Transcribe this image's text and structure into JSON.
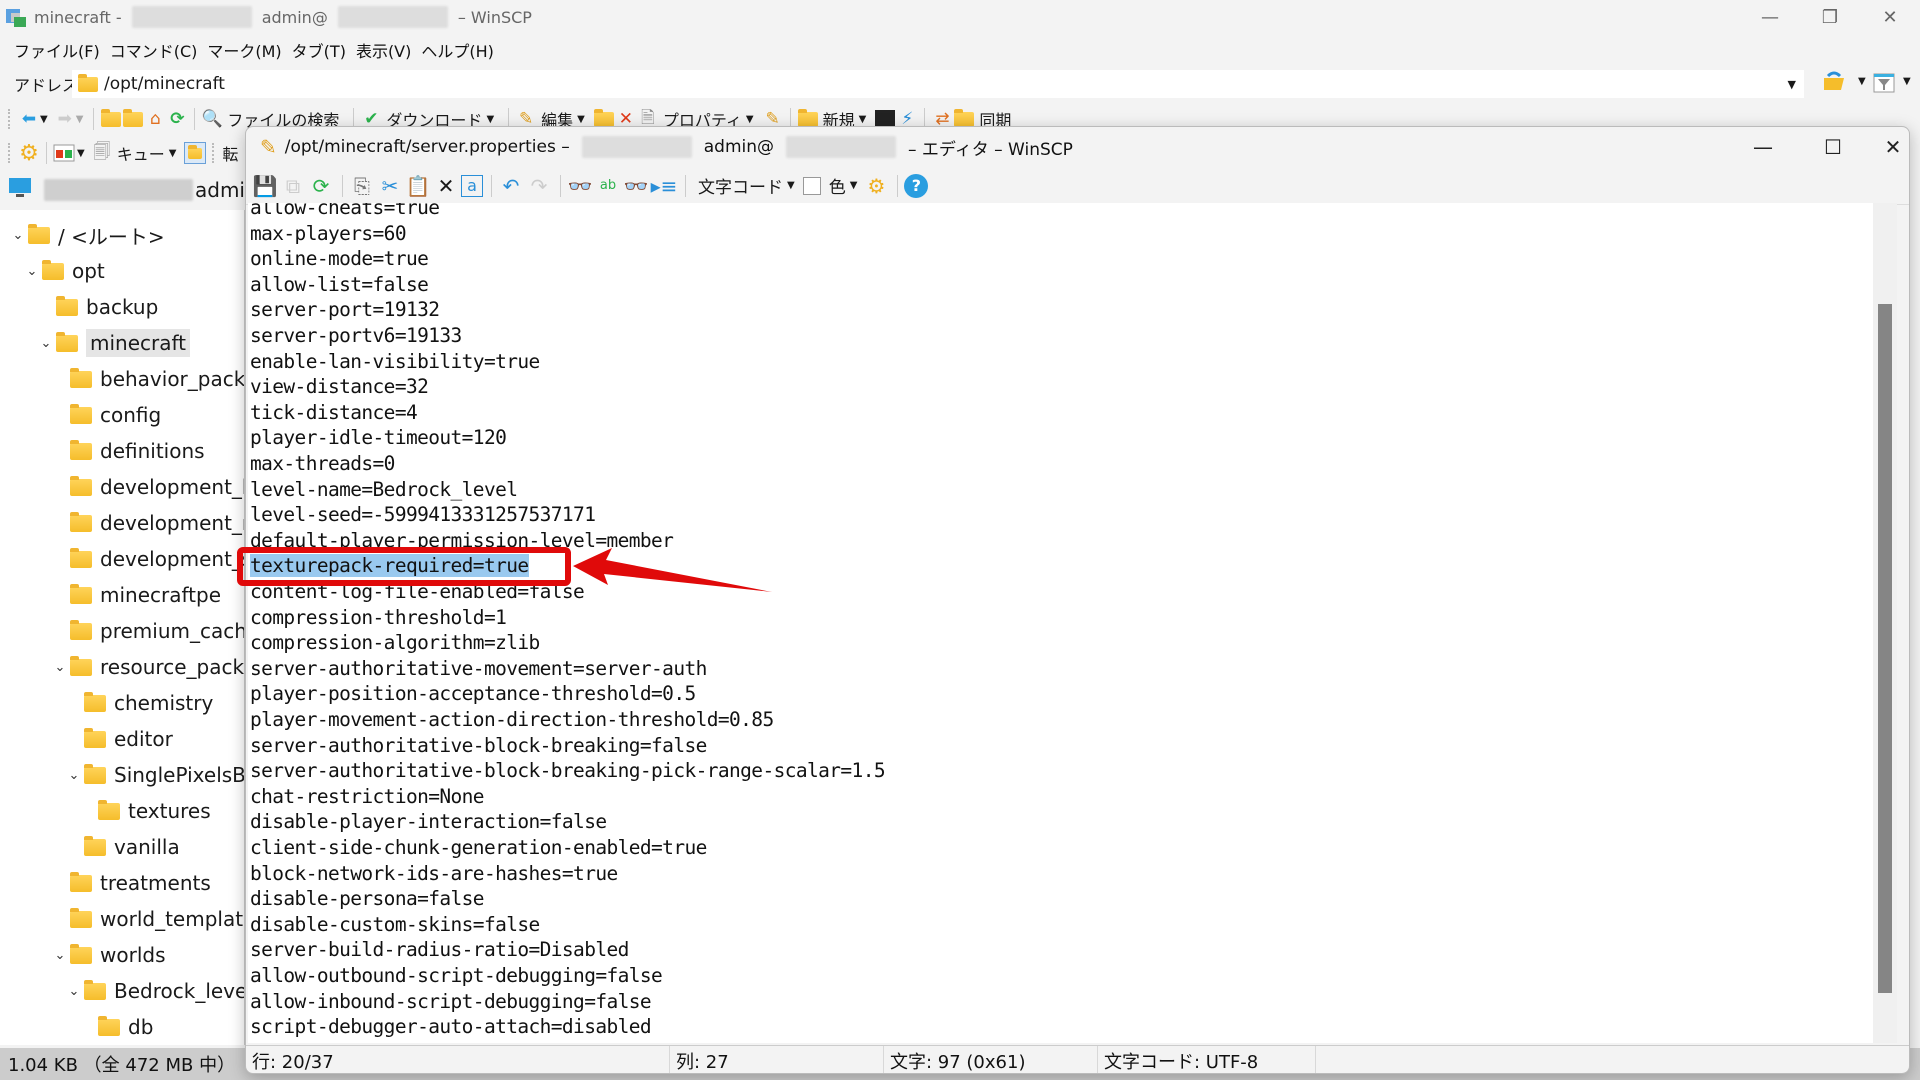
{
  "main_window": {
    "title_prefix": "minecraft -",
    "title_middle": "admin@",
    "title_suffix": "– WinSCP",
    "window_buttons": {
      "minimize": "—",
      "restore": "❐",
      "close": "✕"
    },
    "menu": [
      "ファイル(F)",
      "コマンド(C)",
      "マーク(M)",
      "タブ(T)",
      "表示(V)",
      "ヘルプ(H)"
    ],
    "address_label": "アドレス",
    "address_value": "/opt/minecraft",
    "toolbar1": {
      "find_files": "ファイルの検索",
      "download": "ダウンロード",
      "edit": "編集",
      "properties": "プロパティ",
      "new": "新規",
      "sync": "同期"
    },
    "toolbar2": {
      "queue": "キュー",
      "transfer": "転"
    },
    "session_label": "admi",
    "tree": [
      {
        "label": "/ <ルート>",
        "level": 0,
        "expanded": true
      },
      {
        "label": "opt",
        "level": 1,
        "expanded": true
      },
      {
        "label": "backup",
        "level": 2,
        "expanded": null
      },
      {
        "label": "minecraft",
        "level": 2,
        "expanded": true,
        "selected": true
      },
      {
        "label": "behavior_packs",
        "level": 3,
        "expanded": null
      },
      {
        "label": "config",
        "level": 3,
        "expanded": null
      },
      {
        "label": "definitions",
        "level": 3,
        "expanded": null
      },
      {
        "label": "development_b",
        "level": 3,
        "expanded": null
      },
      {
        "label": "development_r",
        "level": 3,
        "expanded": null
      },
      {
        "label": "development_s",
        "level": 3,
        "expanded": null
      },
      {
        "label": "minecraftpe",
        "level": 3,
        "expanded": null
      },
      {
        "label": "premium_cache",
        "level": 3,
        "expanded": null
      },
      {
        "label": "resource_packs",
        "level": 3,
        "expanded": true
      },
      {
        "label": "chemistry",
        "level": 4,
        "expanded": null
      },
      {
        "label": "editor",
        "level": 4,
        "expanded": null
      },
      {
        "label": "SinglePixelsBe",
        "level": 4,
        "expanded": true
      },
      {
        "label": "textures",
        "level": 5,
        "expanded": null
      },
      {
        "label": "vanilla",
        "level": 4,
        "expanded": null
      },
      {
        "label": "treatments",
        "level": 3,
        "expanded": null
      },
      {
        "label": "world_templates",
        "level": 3,
        "expanded": null
      },
      {
        "label": "worlds",
        "level": 3,
        "expanded": true
      },
      {
        "label": "Bedrock_level",
        "level": 4,
        "expanded": true
      },
      {
        "label": "db",
        "level": 5,
        "expanded": null
      }
    ],
    "status": {
      "size": "1.04 KB （全 472 MB 中）"
    }
  },
  "editor": {
    "title_path": "/opt/minecraft/server.properties –",
    "title_middle": "admin@",
    "title_suffix": "– エディタ – WinSCP",
    "window_buttons": {
      "minimize": "—",
      "maximize": "☐",
      "close": "✕"
    },
    "toolbar": {
      "encoding": "文字コード",
      "color": "色"
    },
    "lines": [
      "allow-cheats=true",
      "max-players=60",
      "online-mode=true",
      "allow-list=false",
      "server-port=19132",
      "server-portv6=19133",
      "enable-lan-visibility=true",
      "view-distance=32",
      "tick-distance=4",
      "player-idle-timeout=120",
      "max-threads=0",
      "level-name=Bedrock_level",
      "level-seed=-5999413331257537171",
      "default-player-permission-level=member",
      "texturepack-required=true",
      "content-log-file-enabled=false",
      "compression-threshold=1",
      "compression-algorithm=zlib",
      "server-authoritative-movement=server-auth",
      "player-position-acceptance-threshold=0.5",
      "player-movement-action-direction-threshold=0.85",
      "server-authoritative-block-breaking=false",
      "server-authoritative-block-breaking-pick-range-scalar=1.5",
      "chat-restriction=None",
      "disable-player-interaction=false",
      "client-side-chunk-generation-enabled=true",
      "block-network-ids-are-hashes=true",
      "disable-persona=false",
      "disable-custom-skins=false",
      "server-build-radius-ratio=Disabled",
      "allow-outbound-script-debugging=false",
      "allow-inbound-script-debugging=false",
      "script-debugger-auto-attach=disabled"
    ],
    "highlighted_line_index": 14,
    "scroll_position": {
      "visible_fraction": 0.82,
      "top_fraction": 0.12
    },
    "status": {
      "line": "行: 20/37",
      "column": "列: 27",
      "char": "文字: 97 (0x61)",
      "encoding": "文字コード: UTF-8"
    }
  },
  "annotation": {
    "color": "#e00a0a",
    "target": "texturepack-required=true"
  }
}
